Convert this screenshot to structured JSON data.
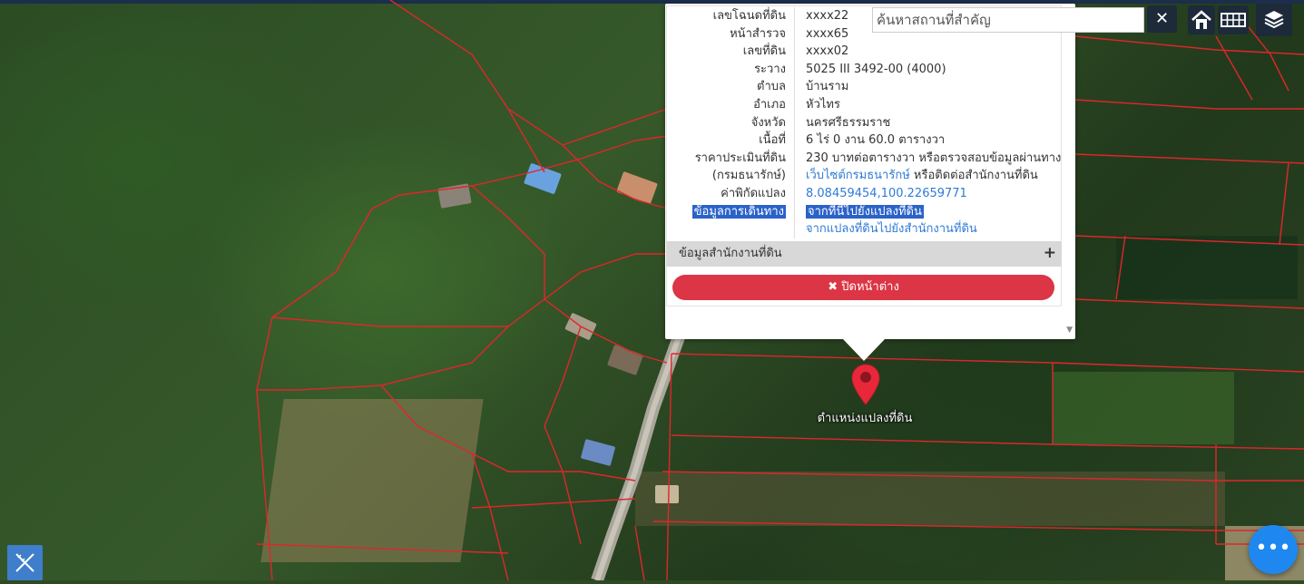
{
  "search": {
    "placeholder": "ค้นหาสถานที่สำคัญ",
    "clear_symbol": "✕"
  },
  "parcel_info": {
    "rows": [
      {
        "label": "เลขโฉนดที่ดิน",
        "value": "xxxx22"
      },
      {
        "label": "หน้าสำรวจ",
        "value": "xxxx65"
      },
      {
        "label": "เลขที่ดิน",
        "value": "xxxx02"
      },
      {
        "label": "ระวาง",
        "value": "5025 III 3492-00 (4000)"
      },
      {
        "label": "ตำบล",
        "value": "บ้านราม"
      },
      {
        "label": "อำเภอ",
        "value": "หัวไทร"
      },
      {
        "label": "จังหวัด",
        "value": "นครศรีธรรมราช"
      },
      {
        "label": "เนื้อที่",
        "value": "6 ไร่ 0 งาน 60.0 ตารางวา"
      },
      {
        "label": "ราคาประเมินที่ดิน",
        "value": "230 บาทต่อตารางวา หรือตรวจสอบข้อมูลผ่านทาง"
      }
    ],
    "price_source_label": "(กรมธนารักษ์)",
    "price_source_link": "เว็บไซต์กรมธนารักษ์",
    "price_source_suffix": " หรือติดต่อสำนักงานที่ดิน",
    "coord_label": "ค่าพิกัดแปลง",
    "coord_value": "8.08459454,100.22659771",
    "route_label": "ข้อมูลการเดินทาง",
    "route_link_1": "จากที่นี่ไปยังแปลงที่ดิน",
    "route_link_2": "จากแปลงที่ดินไปยังสำนักงานที่ดิน"
  },
  "office_section": {
    "label": "ข้อมูลสำนักงานที่ดิน",
    "expand_symbol": "+"
  },
  "close_button": {
    "icon": "✖",
    "label": "ปิดหน้าต่าง"
  },
  "marker": {
    "label": "ตำแหน่งแปลงที่ดิน",
    "color": "#e8283a"
  },
  "fab": {
    "symbol": "•••",
    "color": "#1e88f0"
  },
  "colors": {
    "parcel_line": "#e0262b",
    "close_button": "#dc3545",
    "toolbar": "#1d2a3a",
    "highlight": "#2a62c9"
  },
  "icons": [
    "home-icon",
    "grid-icon",
    "layers-icon",
    "ruler-pencil-icon",
    "more-icon",
    "map-pin-icon"
  ]
}
